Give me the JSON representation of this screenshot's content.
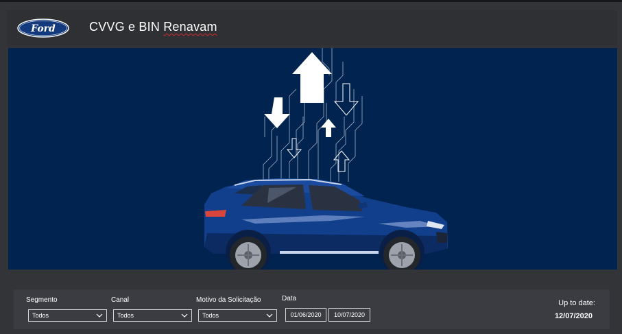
{
  "header": {
    "brand": "Ford",
    "title": "CVVG e BIN Renavam"
  },
  "colors": {
    "background": "#323438",
    "hero": "#00244f",
    "brand_blue": "#133a7c",
    "filter_panel": "#3a3c41"
  },
  "hero": {
    "icons": [
      "circuit-arrows-illustration",
      "suv-car-illustration"
    ]
  },
  "filters": {
    "segmento": {
      "label": "Segmento",
      "value": "Todos"
    },
    "canal": {
      "label": "Canal",
      "value": "Todos"
    },
    "motivo": {
      "label": "Motivo da Solicitação",
      "value": "Todos"
    },
    "data": {
      "label": "Data",
      "start": "01/06/2020",
      "end": "10/07/2020"
    }
  },
  "status": {
    "label": "Up to date:",
    "date": "12/07/2020"
  }
}
